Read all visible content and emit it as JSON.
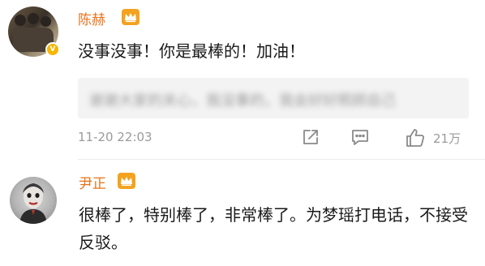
{
  "comments": [
    {
      "username": "陈赫",
      "text": "没事没事！你是最棒的！加油！",
      "quoted_text": "谢谢大家的关心，我没事的，我会好好照顾自己",
      "timestamp": "11-20 22:03",
      "like_count": "21万",
      "badge_icon": "crown-icon",
      "verified_icon": "verified-v-icon"
    },
    {
      "username": "尹正",
      "text": "很棒了，特别棒了，非常棒了。为梦瑶打电话，不接受反驳。",
      "badge_icon": "crown-icon"
    }
  ],
  "colors": {
    "username": "#e8731b",
    "badge": "#f4a21f",
    "meta": "#9b9b9b",
    "quote_bg": "#f3f3f3"
  }
}
